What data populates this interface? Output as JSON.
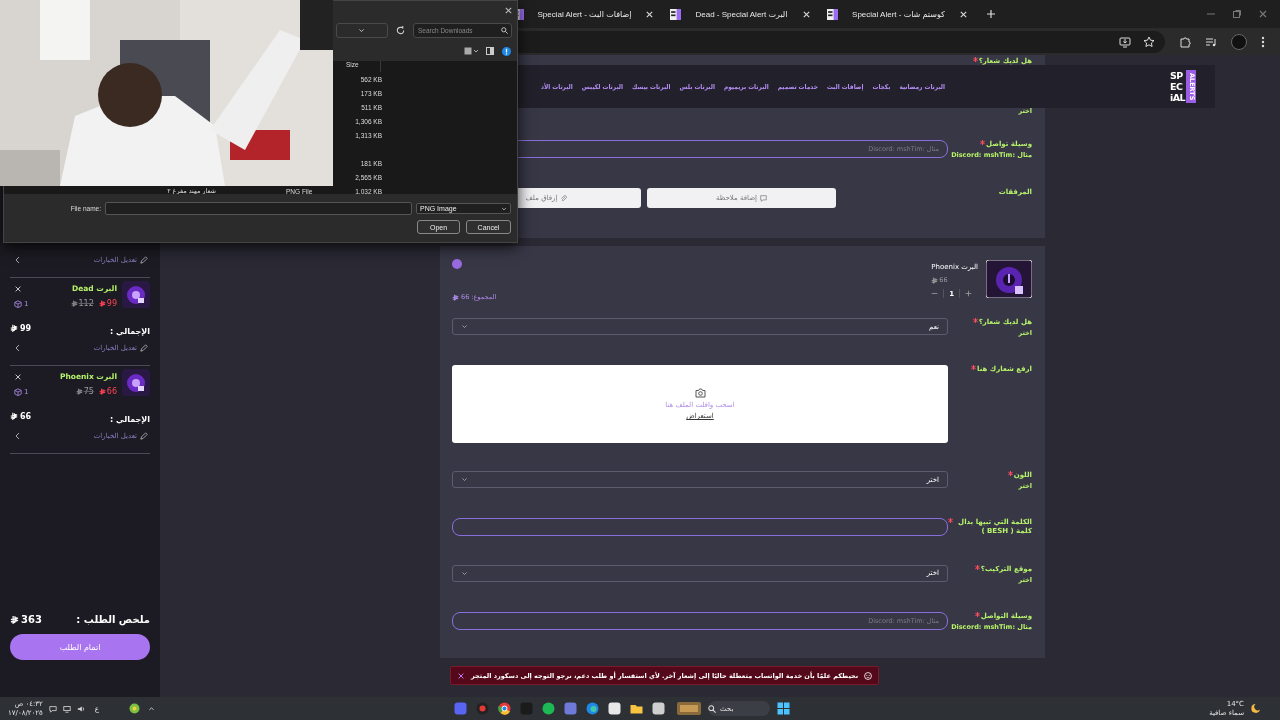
{
  "browser": {
    "tabs": [
      {
        "title": "كوستم شات - Special Alert"
      },
      {
        "title": "البرت Dead - Special Alert"
      },
      {
        "title": "إضافات البث - Special Alert"
      }
    ]
  },
  "file_dialog": {
    "search": {
      "placeholder": "Search Downloads"
    },
    "size_column": "Size",
    "rows": [
      {
        "kind": "file",
        "size": "562 KB"
      },
      {
        "kind": "file",
        "size": "173 KB"
      },
      {
        "kind": "file",
        "size": "511 KB"
      },
      {
        "kind": "file",
        "size": "1,306 KB"
      },
      {
        "kind": "file",
        "size": "1,313 KB"
      },
      {
        "kind": "folder"
      },
      {
        "kind": "file",
        "size": "181 KB"
      },
      {
        "kind": "file",
        "size": "2,565 KB"
      },
      {
        "kind": "file",
        "size": "1,032 KB",
        "name": "شعار مهند مفرغ ٢",
        "type": "PNG File"
      }
    ],
    "file_name_label": "File name:",
    "file_type": "PNG Image",
    "buttons": [
      "Cancel",
      "Open"
    ]
  },
  "site": {
    "logo": {
      "lines": [
        "SP",
        "EC",
        "iAL"
      ],
      "tag": "ALERTS"
    },
    "nav": [
      "البرتات رمضانية",
      "بكجات",
      "إضافات البث",
      "خدمات تصميم",
      "البرتات بريميوم",
      "البرتات بلس",
      "البرتات بيسك",
      "البرتات لكيبس",
      "البرتات الأد"
    ],
    "top_card": {
      "peek": {
        "label": "هل لديك شعار؟",
        "required": true,
        "hint": "اختر"
      },
      "contact": {
        "label": "وسيلة تواصل",
        "required": true,
        "hint": "مثال :Discord: mshTim",
        "placeholder": "مثال :Discord: mshTim"
      },
      "attachments": {
        "label": "المرفقات",
        "buttons": [
          {
            "kind": "note",
            "label": "إضافة ملاحظة"
          },
          {
            "kind": "attach",
            "label": "إرفاق ملف"
          }
        ]
      }
    },
    "product": {
      "name": "البرت Phoenix",
      "price": "66",
      "quantity": "1",
      "total_label": "المجموع:",
      "total": "66"
    },
    "fields": [
      {
        "kind": "select",
        "label": "هل لديك شعار؟",
        "required": true,
        "hint": "اختر",
        "value": "نعم"
      },
      {
        "kind": "upload",
        "label": "ارفع شعارك هنا",
        "required": true,
        "prompt": "اسحب وافلت الملف هنا",
        "link": "استعراض"
      },
      {
        "kind": "select",
        "label": "اللون",
        "required": true,
        "hint": "اختر",
        "value": "اختر"
      },
      {
        "kind": "text",
        "label": "الكلمة التي تبيها بدال كلمة ( BESH )",
        "required": true
      },
      {
        "kind": "select",
        "label": "موقع التركيب؟",
        "required": true,
        "hint": "اختر",
        "value": "اختر"
      },
      {
        "kind": "text",
        "label": "وسيلة التواصل",
        "required": true,
        "hint": "مثال :Discord: mshTim",
        "placeholder": "مثال :Discord: mshTim"
      }
    ]
  },
  "cart": {
    "edit_label": "تعديل الخيارات",
    "items": [
      {
        "name": "البرت Dead",
        "old_price": "112",
        "price": "99",
        "quantity": "1",
        "total_label": "الإجمالي :",
        "total": "99",
        "edit_label": "تعديل الخيارات"
      },
      {
        "name": "البرت Phoenix",
        "old_price": "75",
        "price": "66",
        "quantity": "1",
        "total_label": "الإجمالي :",
        "total": "66",
        "edit_label": "تعديل الخيارات"
      }
    ],
    "summary_label": "ملخص الطلب :",
    "summary_total": "363",
    "checkout": "اتمام الطلب"
  },
  "toast": {
    "message": "نحيطكم علمًا بأن خدمة الواتساب متعطلة حاليًا إلى إشعار آخر. لأي استفسار أو طلب دعم، نرجو التوجه إلى دسكورد المتجر"
  },
  "taskbar": {
    "time": "٠٤:٣٢ ص",
    "date": "١٧/٠٨/٢٠٢٥",
    "language": "ع",
    "search": "بحث",
    "temperature": "14°C",
    "weather": "سماء صافية"
  }
}
